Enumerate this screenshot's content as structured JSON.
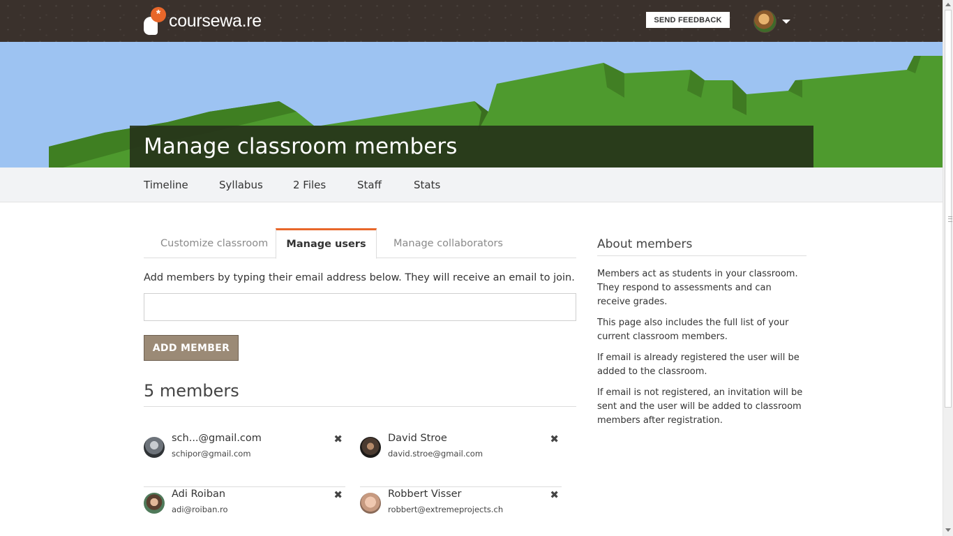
{
  "header": {
    "logo_text": "coursewa.re",
    "feedback_label": "SEND FEEDBACK"
  },
  "banner": {
    "title": "Manage classroom members"
  },
  "nav": {
    "items": [
      "Timeline",
      "Syllabus",
      "2 Files",
      "Staff",
      "Stats"
    ]
  },
  "tabs": [
    "Customize classroom",
    "Manage users",
    "Manage collaborators"
  ],
  "active_tab": "Manage users",
  "form": {
    "intro": "Add members by typing their email address below. They will receive an email to join.",
    "email_value": "",
    "add_label": "ADD MEMBER"
  },
  "members": {
    "heading": "5 members",
    "list": [
      {
        "name": "sch...@gmail.com",
        "email": "schipor@gmail.com"
      },
      {
        "name": "David Stroe",
        "email": "david.stroe@gmail.com"
      },
      {
        "name": "Adi Roiban",
        "email": "adi@roiban.ro"
      },
      {
        "name": "Robbert Visser",
        "email": "robbert@extremeprojects.ch"
      }
    ]
  },
  "about": {
    "title": "About members",
    "paragraphs": [
      "Members act as students in your classroom. They respond to assessments and can receive grades.",
      "This page also includes the full list of your current classroom members.",
      "If email is already registered the user will be added to the classroom.",
      "If email is not registered, an invitation will be sent and the user will be added to classroom members after registration."
    ]
  },
  "colors": {
    "topbar": "#3a312c",
    "accent_orange": "#e8672a",
    "sky": "#9dc3f2",
    "grass": "#4e9a2e",
    "button_brown": "#9b8a76"
  },
  "icons": {
    "remove": "close-icon",
    "profile_menu": "chevron-down-icon"
  }
}
